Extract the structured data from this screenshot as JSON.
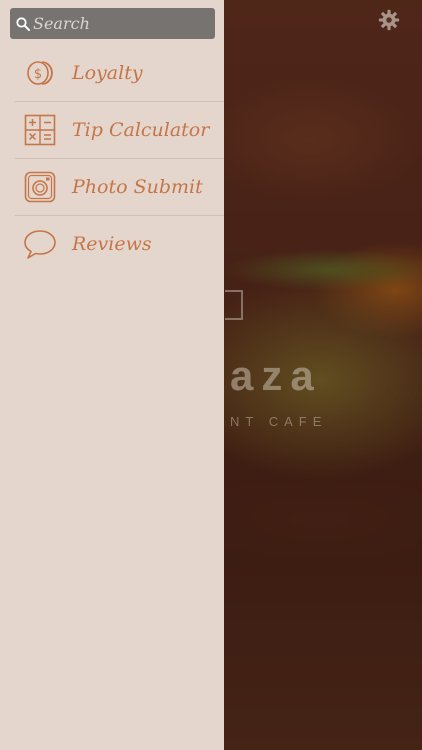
{
  "background": {
    "logo_text": "aza",
    "logo_subtitle": "NT CAFE"
  },
  "header": {
    "settings_icon": "gear-icon"
  },
  "drawer": {
    "search": {
      "placeholder": "Search",
      "icon": "search-icon"
    },
    "items": [
      {
        "label": "Loyalty",
        "icon": "dollar-coin-icon"
      },
      {
        "label": "Tip Calculator",
        "icon": "calculator-icon"
      },
      {
        "label": "Photo Submit",
        "icon": "camera-icon"
      },
      {
        "label": "Reviews",
        "icon": "speech-bubble-icon"
      }
    ]
  },
  "colors": {
    "drawer_bg": "#e5d6cd",
    "accent": "#c47648",
    "search_bg": "#767371"
  }
}
